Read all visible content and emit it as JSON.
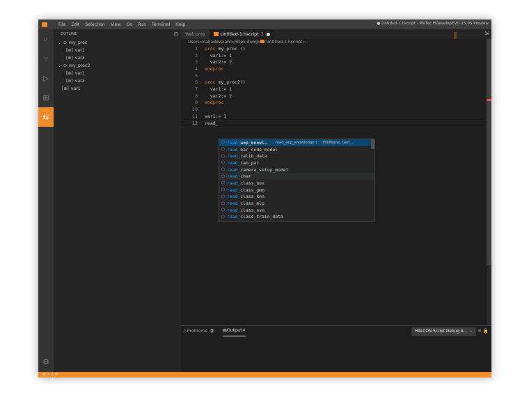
{
  "titlebar": {
    "menu": [
      "File",
      "Edit",
      "Selection",
      "View",
      "Go",
      "Run",
      "Terminal",
      "Help"
    ],
    "title": "● Untitled-1.hscript - MVTec HDevelopEVO 25.05 Preview"
  },
  "activity_bar": {
    "items": [
      "search-icon",
      "source-control-icon",
      "run-debug-icon",
      "extensions-icon",
      "halcon-icon"
    ],
    "active": "halcon-icon",
    "bottom": "settings-gear-icon"
  },
  "sidebar": {
    "header": "OUTLINE",
    "tree": [
      {
        "label": "my_proc",
        "kind": "procedure",
        "expanded": true,
        "indent": 0,
        "chevron": "⌄",
        "icon": "⊙"
      },
      {
        "label": "var1",
        "kind": "variable",
        "indent": 1,
        "icon": "[⊗]"
      },
      {
        "label": "var2",
        "kind": "variable",
        "indent": 1,
        "icon": "[⊗]"
      },
      {
        "label": "my_proc2",
        "kind": "procedure",
        "expanded": true,
        "indent": 0,
        "chevron": "⌄",
        "icon": "⊙"
      },
      {
        "label": "var1",
        "kind": "variable",
        "indent": 1,
        "icon": "[⊗]"
      },
      {
        "label": "var2",
        "kind": "variable",
        "indent": 1,
        "icon": "[⊗]"
      },
      {
        "label": "var1",
        "kind": "variable",
        "indent": 0.5,
        "icon": "[⊗]"
      }
    ]
  },
  "tabs": [
    {
      "label": "Welcome",
      "active": false
    },
    {
      "label": "Untitled-1.hscript",
      "active": true,
      "problems": "3",
      "dirty": "●"
    }
  ],
  "breadcrumb": [
    "Users",
    "mahadevaiahn",
    "HDev-dump",
    "Untitled-1.hscript",
    "..."
  ],
  "code": [
    {
      "n": "1",
      "parts": [
        {
          "t": "proc",
          "c": "kw"
        },
        {
          "t": " my_proc ()",
          "c": "tx"
        }
      ]
    },
    {
      "n": "2",
      "parts": [
        {
          "t": "  var1:= 1",
          "c": "tx"
        }
      ]
    },
    {
      "n": "3",
      "parts": [
        {
          "t": "  var2:= 2",
          "c": "tx"
        }
      ]
    },
    {
      "n": "4",
      "parts": [
        {
          "t": "endproc",
          "c": "kw"
        }
      ]
    },
    {
      "n": "5",
      "parts": []
    },
    {
      "n": "6",
      "parts": [
        {
          "t": "proc",
          "c": "kw"
        },
        {
          "t": " my_proc2()",
          "c": "tx"
        }
      ]
    },
    {
      "n": "7",
      "parts": [
        {
          "t": "  var1:= 1",
          "c": "tx"
        }
      ]
    },
    {
      "n": "8",
      "parts": [
        {
          "t": "  var2:= 2",
          "c": "tx"
        }
      ]
    },
    {
      "n": "9",
      "parts": [
        {
          "t": "endproc",
          "c": "kw"
        }
      ]
    },
    {
      "n": "10",
      "parts": []
    },
    {
      "n": "11",
      "parts": [
        {
          "t": "var1:= 1",
          "c": "tx"
        }
      ]
    },
    {
      "n": "12",
      "parts": [
        {
          "t": "read_",
          "c": "tx"
        }
      ],
      "current": true
    }
  ],
  "suggestions": {
    "prefix": "read_",
    "items": [
      {
        "rest": "aop_knowl…",
        "detail": "read_aop_knowledge ( : : FileName, Gen…",
        "state": "selected"
      },
      {
        "rest": "bar_code_model"
      },
      {
        "rest": "calib_data"
      },
      {
        "rest": "cam_par"
      },
      {
        "rest": "camera_setup_model"
      },
      {
        "rest": "char",
        "state": "hover"
      },
      {
        "rest": "class_box"
      },
      {
        "rest": "class_gmm"
      },
      {
        "rest": "class_knn"
      },
      {
        "rest": "class_mlp"
      },
      {
        "rest": "class_svm"
      },
      {
        "rest": "class_train_data"
      }
    ]
  },
  "panel": {
    "tabs": [
      {
        "label": "Problems",
        "badge": "3",
        "icon": "⚠",
        "active": false
      },
      {
        "label": "Output",
        "icon": "▤",
        "active": true,
        "close": "✕"
      }
    ],
    "select": "HALCON Script Debug A...",
    "select_chevron": "⌄",
    "icons": "≡ 🔒"
  },
  "statusbar": {
    "text": "⊗ 1 ⚠ 0"
  }
}
